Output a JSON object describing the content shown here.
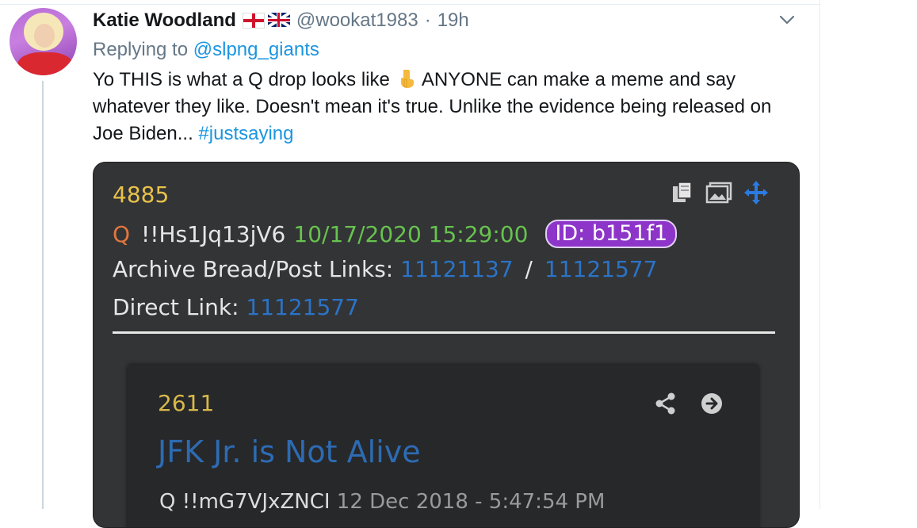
{
  "tweet": {
    "author_name": "Katie Woodland",
    "handle": "@wookat1983",
    "separator": "·",
    "time": "19h",
    "replying_to_prefix": "Replying to",
    "replying_to_user": "@slpng_giants",
    "text_part1": "Yo THIS is what a Q drop looks like",
    "text_part2": "ANYONE can make a meme and say whatever they like. Doesn't mean it's true. Unlike the evidence being released on Joe Biden...",
    "hashtag": "#justsaying",
    "link_color": "#1b95e0"
  },
  "image_post": {
    "post_number": "4885",
    "q_letter": "Q",
    "tripcode": "!!Hs1Jq13jV6",
    "datetime": "10/17/2020 15:29:00",
    "id_badge": "ID: b151f1",
    "archive_label": "Archive Bread/Post Links:",
    "archive_link_1": "11121137",
    "archive_sep": "/",
    "archive_link_2": "11121577",
    "direct_label": "Direct Link:",
    "direct_link": "11121577",
    "icons": [
      "copy-icon",
      "image-icon",
      "move-icon"
    ],
    "quoted": {
      "number": "2611",
      "title": "JFK Jr. is Not Alive",
      "q_letter": "Q",
      "tripcode": "!!mG7VJxZNCI",
      "date": "12 Dec 2018 - 5:47:54 PM",
      "icons": [
        "share-icon",
        "arrow-right-circle-icon"
      ]
    }
  }
}
